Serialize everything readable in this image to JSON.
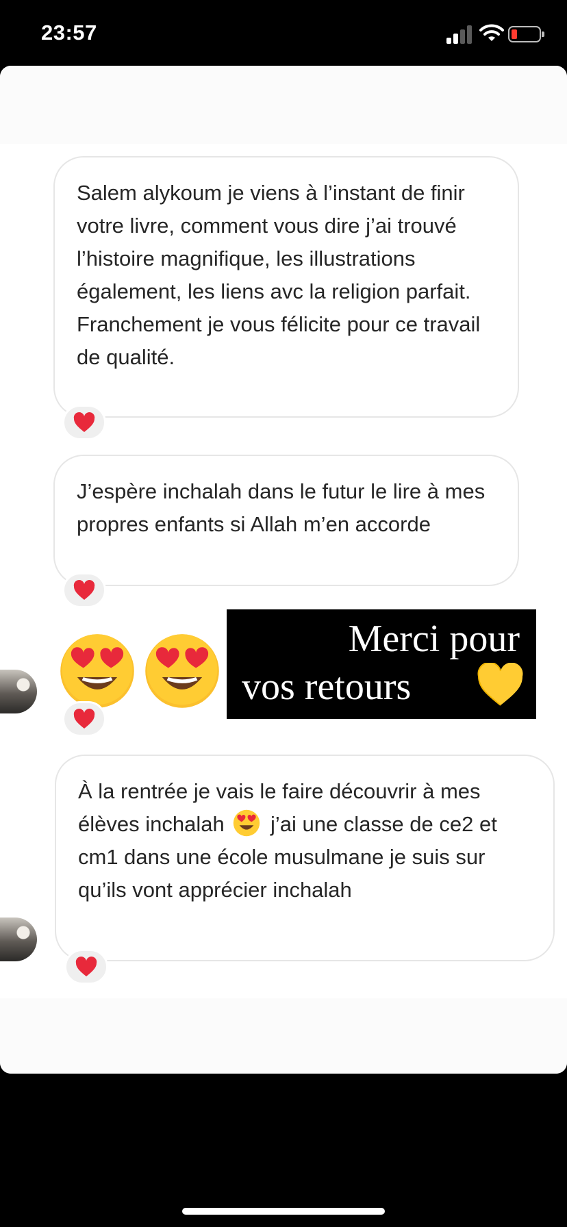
{
  "status": {
    "time": "23:57",
    "battery_color": "#ff3b30"
  },
  "messages": [
    {
      "text": "Salem alykoum je viens à l’instant de finir votre livre, comment vous dire j’ai trouvé l’histoire magnifique, les illustrations également, les liens avc la religion parfait. Franchement je vous félicite pour ce travail de qualité.",
      "reaction": "heart-icon"
    },
    {
      "text": "J’espère inchalah dans le futur le lire à mes propres enfants si Allah m’en accorde",
      "reaction": "heart-icon"
    },
    {
      "emoji": [
        "heart-eyes-emoji",
        "heart-eyes-emoji"
      ],
      "reaction": "heart-icon"
    },
    {
      "text_before_emoji": "À la rentrée je vais le faire découvrir à mes élèves inchalah",
      "inline_emoji": "heart-eyes-emoji",
      "text_after_emoji": "j’ai une classe de ce2 et cm1 dans une école musulmane je suis sur qu’ils vont apprécier inchalah",
      "reaction": "heart-icon"
    }
  ],
  "story_reply": {
    "line1": "Merci pour",
    "line2": "vos retours",
    "icon": "yellow-heart-icon",
    "icon_color": "#ffcc33"
  },
  "colors": {
    "reaction_heart": "#e8293b",
    "bubble_border": "#e6e6e6",
    "text": "#262626"
  }
}
